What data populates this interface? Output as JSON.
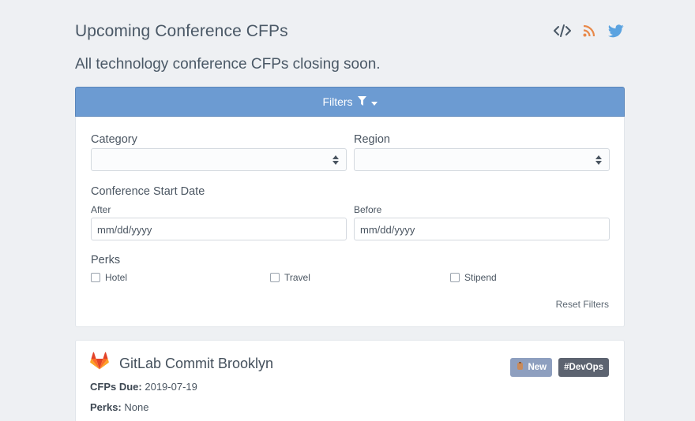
{
  "header": {
    "title": "Upcoming Conference CFPs",
    "subtitle": "All technology conference CFPs closing soon.",
    "icons": [
      "code-icon",
      "rss-icon",
      "twitter-icon"
    ],
    "colors": {
      "rss": "#e8894a",
      "twitter": "#5ba3e0",
      "code": "#4a5866"
    }
  },
  "filters": {
    "toggle_label": "Filters",
    "category_label": "Category",
    "category_value": "",
    "region_label": "Region",
    "region_value": "",
    "start_date_label": "Conference Start Date",
    "after_label": "After",
    "after_placeholder": "mm/dd/yyyy",
    "before_label": "Before",
    "before_placeholder": "mm/dd/yyyy",
    "perks_label": "Perks",
    "perks": [
      {
        "label": "Hotel",
        "checked": false
      },
      {
        "label": "Travel",
        "checked": false
      },
      {
        "label": "Stipend",
        "checked": false
      }
    ],
    "reset_label": "Reset Filters",
    "bar_color": "#6c9bd2"
  },
  "conferences": [
    {
      "name": "GitLab Commit Brooklyn",
      "logo": "gitlab-icon",
      "badges": {
        "new": "New",
        "tag": "#DevOps"
      },
      "cfps_due_label": "CFPs Due:",
      "cfps_due": "2019-07-19",
      "perks_label": "Perks:",
      "perks": "None"
    }
  ]
}
